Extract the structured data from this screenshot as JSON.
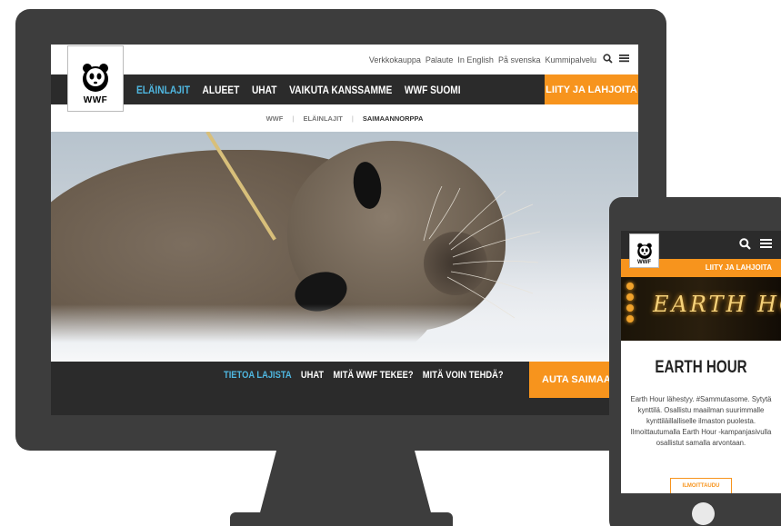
{
  "colors": {
    "accent": "#f7941d",
    "nav_bg": "#2b2b2b",
    "active_link": "#4fb7e0",
    "device": "#3d3d3d"
  },
  "desktop": {
    "utility_links": [
      "Verkkokauppa",
      "Palaute",
      "In English",
      "På svenska",
      "Kummipalvelu"
    ],
    "utility_icons": [
      "search-icon",
      "menu-icon"
    ],
    "logo_text": "WWF",
    "nav": {
      "items": [
        "ELÄINLAJIT",
        "ALUEET",
        "UHAT",
        "VAIKUTA KANSSAMME",
        "WWF SUOMI"
      ],
      "active": "ELÄINLAJIT",
      "cta": "LIITY JA LAHJOITA"
    },
    "breadcrumb": [
      "WWF",
      "ELÄINLAJIT",
      "SAIMAANNORPPA"
    ],
    "subnav": {
      "items": [
        "TIETOA LAJISTA",
        "UHAT",
        "MITÄ WWF TEKEE?",
        "MITÄ VOIN TEHDÄ?"
      ],
      "active": "TIETOA LAJISTA",
      "cta": "AUTA SAIMAANNORPPAA"
    }
  },
  "mobile": {
    "logo_text": "WWF",
    "icons": [
      "search-icon",
      "menu-icon"
    ],
    "cta": "LIITY JA LAHJOITA",
    "banner_text": "EARTH HOUR",
    "title": "EARTH HOUR",
    "body": "Earth Hour lähestyy. #Sammutasome. Sytytä kynttilä. Osallistu maailman suurimmalle kynttiläillalliselle ilmaston puolesta. Ilmoittautumalla Earth Hour -kampanjasivulla osallistut samalla arvontaan.",
    "button": "ILMOITTAUDU"
  }
}
